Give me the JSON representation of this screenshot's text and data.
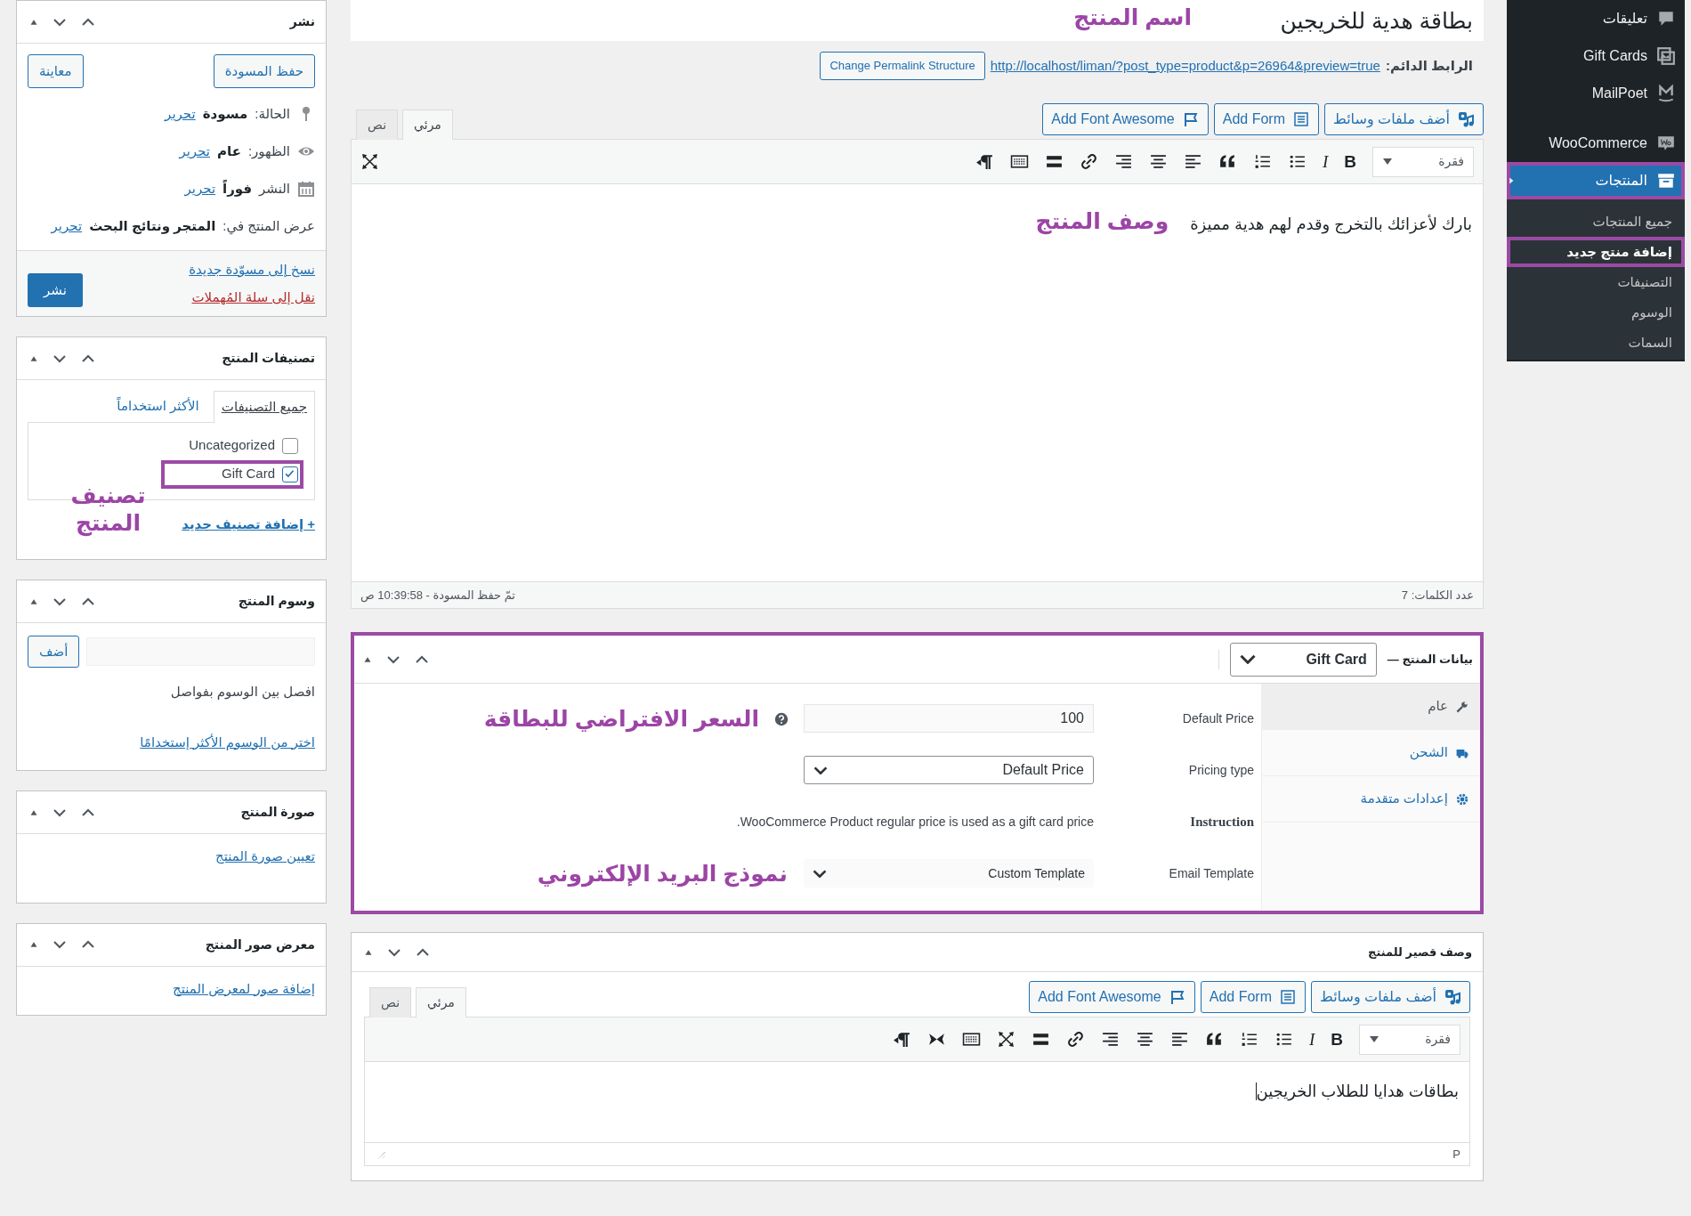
{
  "admin_menu": {
    "items": [
      {
        "kind": "comment",
        "label": "تعليقات",
        "selected": false,
        "highlighted": false
      },
      {
        "kind": "gift",
        "label": "Gift Cards",
        "selected": false,
        "highlighted": false
      },
      {
        "kind": "mail",
        "label": "MailPoet",
        "selected": false,
        "highlighted": false
      },
      {
        "kind": "shop",
        "label": "WooCommerce",
        "selected": false,
        "highlighted": false
      },
      {
        "kind": "products",
        "label": "المنتجات",
        "selected": true,
        "highlighted": true
      }
    ],
    "submenu": [
      {
        "label": "جميع المنتجات",
        "selected": false,
        "highlighted": false
      },
      {
        "label": "إضافة منتج جديد",
        "selected": true,
        "highlighted": true
      },
      {
        "label": "التصنيفات",
        "selected": false,
        "highlighted": false
      },
      {
        "label": "الوسوم",
        "selected": false,
        "highlighted": false
      },
      {
        "label": "السمات",
        "selected": false,
        "highlighted": false
      }
    ]
  },
  "title": {
    "value": "بطاقة هدية للخريجين",
    "annotation": "اسم المنتج"
  },
  "permalink": {
    "label": "الرابط الدائم:",
    "url": "http://localhost/liman/?post_type=product&p=26964&preview=true",
    "button": "Change Permalink Structure"
  },
  "description_editor": {
    "kind": "main",
    "media_buttons": [
      {
        "kind": "media",
        "label": "أضف ملفات وسائط"
      },
      {
        "kind": "form",
        "label": "Add Form"
      },
      {
        "kind": "flag",
        "label": "Add Font Awesome"
      }
    ],
    "tabs": [
      {
        "label": "مرئي",
        "selected": true
      },
      {
        "label": "نص",
        "selected": false
      }
    ],
    "format_select": "فقرة",
    "bold": "B",
    "italic": "I",
    "content": "بارك لأعزائك بالتخرج وقدم لهم هدية مميزة",
    "annotation": "وصف المنتج",
    "word_count": "عدد الكلمات: 7",
    "autosave": "تمّ حفظ المسودة - 10:39:58 ص"
  },
  "product_data": {
    "title": "بيانات المنتج —",
    "type_select": "Gift Card",
    "highlighted": true,
    "tabs": [
      {
        "kind": "general",
        "label": "عام",
        "selected": true
      },
      {
        "kind": "shipping",
        "label": "الشحن",
        "selected": false
      },
      {
        "kind": "advanced",
        "label": "إعدادات متقدمة",
        "selected": false
      }
    ],
    "fields": [
      {
        "kind": "input",
        "label": "Default Price",
        "value": "100",
        "annotation": "السعر الافتراضي للبطاقة"
      },
      {
        "kind": "select",
        "label": "Pricing type",
        "value": "Default Price"
      },
      {
        "kind": "note",
        "label": "Instruction",
        "value": "WooCommerce Product regular price is used as a gift card price."
      },
      {
        "kind": "plain-select",
        "label": "Email Template",
        "value": "Custom Template",
        "annotation": "نموذج البريد الإلكتروني"
      }
    ]
  },
  "short_description": {
    "title": "وصف قصير للمنتج",
    "editor": {
      "kind": "short",
      "media_buttons": [
        {
          "kind": "media",
          "label": "أضف ملفات وسائط"
        },
        {
          "kind": "form",
          "label": "Add Form"
        },
        {
          "kind": "flag",
          "label": "Add Font Awesome"
        }
      ],
      "tabs": [
        {
          "label": "مرئي",
          "selected": true
        },
        {
          "label": "نص",
          "selected": false
        }
      ],
      "format_select": "فقرة",
      "bold": "B",
      "italic": "I",
      "content": "بطاقات هدايا للطلاب الخريجين",
      "path": "P"
    }
  },
  "publish": {
    "title": "نشر",
    "save_draft": "حفظ المسودة",
    "preview": "معاينة",
    "rows": [
      {
        "kind": "status",
        "label": "الحالة:",
        "value": "مسودة",
        "link": "تحرير"
      },
      {
        "kind": "visibility",
        "label": "الظهور:",
        "value": "عام",
        "link": "تحرير"
      },
      {
        "kind": "schedule",
        "label": "النشر",
        "value": "فوراً",
        "link": "تحرير"
      },
      {
        "kind": "catalog",
        "label": "عرض المنتج في:",
        "value": "المتجر ونتائج البحث",
        "link": "تحرير"
      }
    ],
    "copy_link": "نسخ إلى مسوّدة جديدة",
    "trash_link": "نقل إلى سلة المُهملات",
    "publish_button": "نشر"
  },
  "categories": {
    "title": "تصنيفات المنتج",
    "tabs": [
      {
        "label": "جميع التصنيفات",
        "selected": true
      },
      {
        "label": "الأكثر استخداماً",
        "selected": false
      }
    ],
    "items": [
      {
        "label": "Uncategorized",
        "checked": false,
        "highlighted": false
      },
      {
        "label": "Gift Card",
        "checked": true,
        "highlighted": true
      }
    ],
    "annotation": "تصنيف المنتج",
    "add_link": "+ إضافة تصنيف جديد"
  },
  "tags": {
    "title": "وسوم المنتج",
    "add_button": "أضف",
    "hint": "افصل بين الوسوم بفواصل",
    "link": "اختر من الوسوم الأكثر إستخدامًا"
  },
  "product_image": {
    "title": "صورة المنتج",
    "link": "تعيين صورة المنتج"
  },
  "gallery": {
    "title": "معرض صور المنتج",
    "link": "إضافة صور لمعرض المنتج"
  }
}
